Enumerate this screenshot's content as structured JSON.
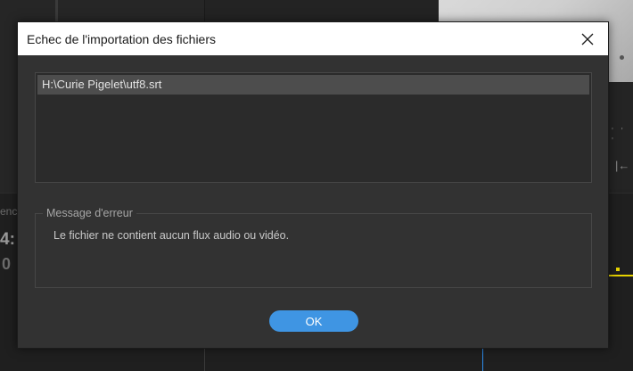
{
  "background": {
    "partial_text": "enc",
    "timecode_partial": "4:",
    "timecode_partial_2": "0",
    "ticks": "' ' '",
    "step_icon": "|←"
  },
  "dialog": {
    "title": "Echec de l'importation des fichiers",
    "close_icon": "close-icon",
    "files": [
      {
        "path": "H:\\Curie Pigelet\\utf8.srt",
        "selected": true
      }
    ],
    "error_group_label": "Message d'erreur",
    "error_message": "Le fichier ne contient aucun flux audio ou vidéo.",
    "ok_label": "OK"
  },
  "colors": {
    "accent_button": "#3f95e3",
    "dialog_bg": "#323232",
    "selected_row": "#4d4d4d",
    "playhead": "#2d8ceb",
    "marker": "#e8d400"
  }
}
